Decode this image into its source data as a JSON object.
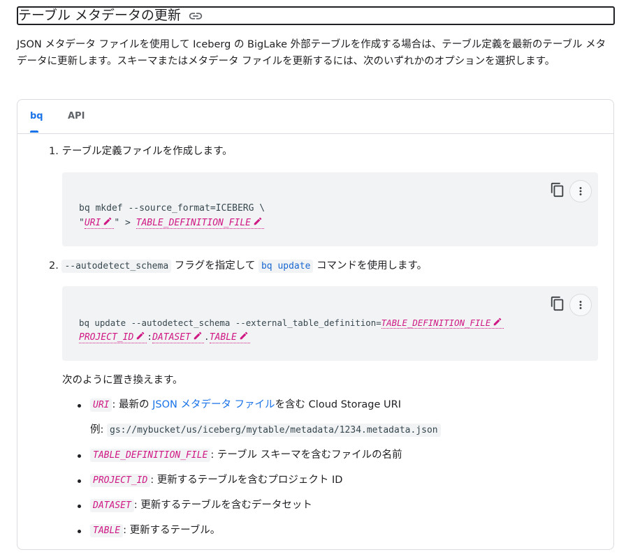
{
  "heading": {
    "title": "テーブル メタデータの更新"
  },
  "intro": {
    "text": "JSON メタデータ ファイルを使用して Iceberg の BigLake 外部テーブルを作成する場合は、テーブル定義を最新のテーブル メタデータに更新します。スキーマまたはメタデータ ファイルを更新するには、次のいずれかのオプションを選択します。"
  },
  "tabs": [
    {
      "label": "bq"
    },
    {
      "label": "API"
    }
  ],
  "step1": {
    "number": "1.",
    "text": "テーブル定義ファイルを作成します。",
    "code_line1": "bq mkdef --source_format=ICEBERG \\",
    "quote_open": "\"",
    "var_uri": "URI",
    "quote_close": "\" > ",
    "var_table_def_file": "TABLE_DEFINITION_FILE"
  },
  "step2": {
    "number": "2.",
    "flag": "--autodetect_schema",
    "text_mid": " フラグを指定して ",
    "command": "bq update",
    "text_end": " コマンドを使用します。",
    "code_prefix": "bq update --autodetect_schema --external_table_definition=",
    "var_table_def_file": "TABLE_DEFINITION_FILE",
    "var_project_id": "PROJECT_ID",
    "sep1": ":",
    "var_dataset": "DATASET",
    "sep2": ".",
    "var_table": "TABLE"
  },
  "replace": {
    "intro": "次のように置き換えます。",
    "items": [
      {
        "var": "URI",
        "pre": ": 最新の ",
        "link": "JSON メタデータ ファイル",
        "post": "を含む Cloud Storage URI"
      },
      {
        "var": "TABLE_DEFINITION_FILE",
        "desc": ": テーブル スキーマを含むファイルの名前"
      },
      {
        "var": "PROJECT_ID",
        "desc": ": 更新するテーブルを含むプロジェクト ID"
      },
      {
        "var": "DATASET",
        "desc": ": 更新するテーブルを含むデータセット"
      },
      {
        "var": "TABLE",
        "desc": ": 更新するテーブル。"
      }
    ],
    "example_label": "例: ",
    "example_value": "gs://mybucket/us/iceberg/mytable/metadata/1234.metadata.json"
  },
  "colors": {
    "accent": "#1a73e8",
    "variable": "#d01884",
    "code_bg": "#f1f3f4"
  },
  "icons": [
    "link-icon",
    "copy-icon",
    "more-vert-icon",
    "pencil-icon"
  ]
}
